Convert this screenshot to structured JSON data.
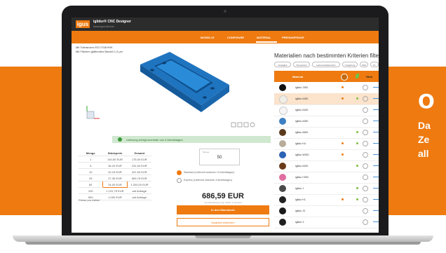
{
  "banner": {
    "title": "O",
    "lines": [
      "Da",
      "Ze",
      "all"
    ]
  },
  "app": {
    "logo": "igus",
    "title": "iglidur® CNC Designer",
    "subtitle": "www.igus.de/cnc"
  },
  "nav": {
    "items": [
      "MODELLE",
      "CONFIGURE",
      "MATERIAL",
      "PREISANFRAGE"
    ]
  },
  "viewer": {
    "options": [
      "Mit Toleranzen ISO 2768 fH/K",
      "Mit Flächen glättendes Bauteil 1,3 µm"
    ],
    "status_bar": "Lieferung erfolgt innerhalb von 3 Arbeitstagen"
  },
  "price_table": {
    "headers": [
      "Menge",
      "Stückpreis",
      "Gesamt"
    ],
    "rows": [
      [
        "1",
        "140,50 EUR",
        "175,00 EUR"
      ],
      [
        "5",
        "46,20 EUR",
        "231,00 EUR"
      ],
      [
        "10",
        "42,15 EUR",
        "421,50 EUR"
      ],
      [
        "25",
        "27,35 EUR",
        "683,75 EUR"
      ],
      [
        "50",
        "24,00 EUR",
        "1.200,00 EUR"
      ],
      [
        "100",
        "1.131,75 EUR",
        "auf Anfrage"
      ],
      [
        "500",
        "1.000 EUR",
        "auf Anfrage"
      ]
    ]
  },
  "favorites": "Preise pro Artikel",
  "order": {
    "qty_label": "Menge",
    "qty_value": "50",
    "options": [
      "Standard (Lieferzeit zwischen 10 Arbeitstagen)",
      "Express (Lieferzeit zwischen 3 Arbeitstagen)"
    ],
    "price": "686,59 EUR",
    "price_note": "inkl. Bearbeitung zzgl. MwSt. & Versand",
    "cart_button": "In den Warenkorb",
    "quote_button": "Angebot anfordern"
  },
  "materials": {
    "title": "Materialien nach bestimmten Kriterien filtern",
    "filters": [
      "Festigkeit",
      "Temperatur",
      "Lebensmittelkonform",
      "Umgebung",
      "FDA",
      "UL"
    ],
    "header_label": "Material",
    "header_right": "Gleit",
    "rows": [
      {
        "name": "iglidur J350",
        "color": "#111111",
        "od": true,
        "gd": false
      },
      {
        "name": "iglidur A180",
        "color": "#f1eee6",
        "od": true,
        "gd": true,
        "highlight": true
      },
      {
        "name": "iglidur A160",
        "color": "#f5f5f5",
        "od": false,
        "gd": false
      },
      {
        "name": "iglidur A250",
        "color": "#3d7fc2",
        "od": false,
        "gd": false
      },
      {
        "name": "iglidur A500",
        "color": "#5b3a1c",
        "od": false,
        "gd": true
      },
      {
        "name": "iglidur H4",
        "color": "#b8ac9a",
        "od": true,
        "gd": true
      },
      {
        "name": "iglidur W300",
        "color": "#2b63b5",
        "od": true,
        "gd": false
      },
      {
        "name": "iglidur A200",
        "color": "#6a3b1b",
        "od": false,
        "gd": true
      },
      {
        "name": "iglidur C500",
        "color": "#e06ea0",
        "od": false,
        "gd": false
      },
      {
        "name": "iglidur J",
        "color": "#4a4a4a",
        "od": false,
        "gd": true
      },
      {
        "name": "iglidur H1",
        "color": "#222222",
        "od": true,
        "gd": true
      },
      {
        "name": "iglidur J3",
        "color": "#1a1a1a",
        "od": false,
        "gd": false
      },
      {
        "name": "iglidur X",
        "color": "#202020",
        "od": false,
        "gd": false
      }
    ]
  },
  "colors": {
    "accent": "#ee7a10",
    "header": "#2c2c2c",
    "part": "#2a8cd9",
    "success": "#cfe8cf"
  }
}
